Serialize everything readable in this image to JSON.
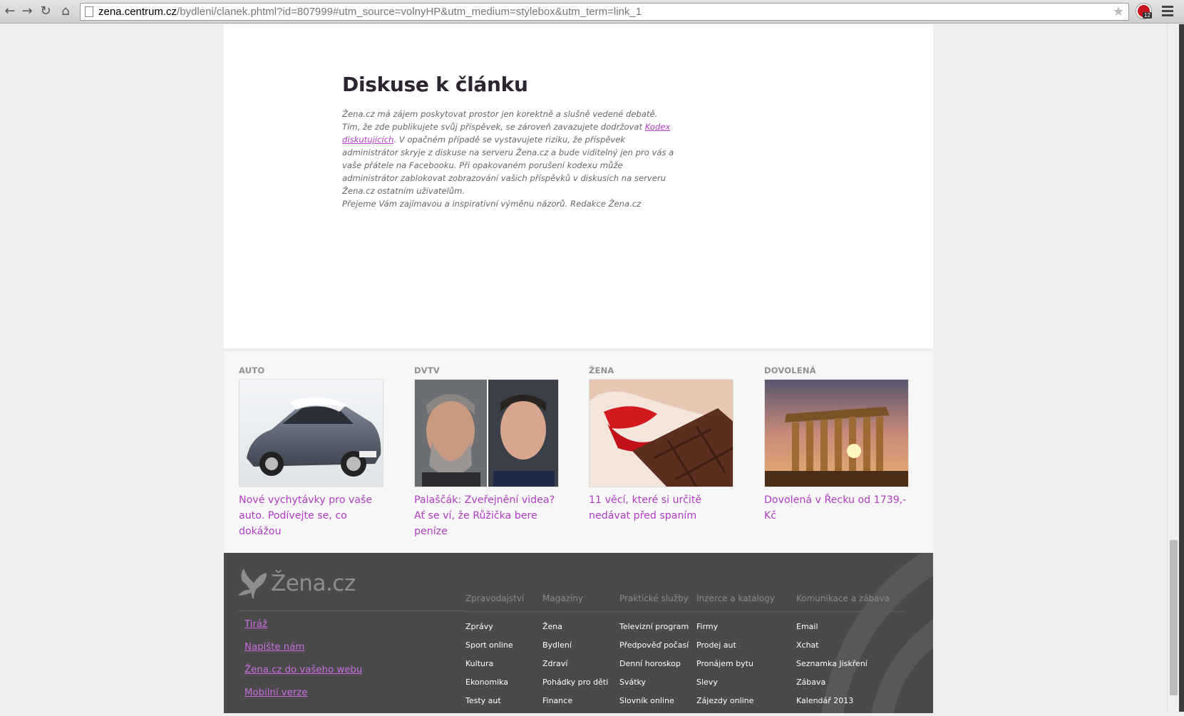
{
  "browser": {
    "url_host": "zena.centrum.cz",
    "url_path": "/bydleni/clanek.phtml?id=807999#utm_source=volnyHP&utm_medium=stylebox&utm_term=link_1",
    "extension_badge": "12"
  },
  "discussion": {
    "title": "Diskuse k článku",
    "text_1": "Žena.cz má zájem poskytovat prostor jen korektně a slušně vedené debatě. Tím, že zde publikujete svůj příspěvek, se zároveň zavazujete dodržovat ",
    "code_link": "Kodex diskutujících",
    "text_2": ". V opačném případě se vystavujete riziku, že příspěvek administrátor skryje z diskuse na serveru Žena.cz a bude viditelný jen pro vás a vaše přátele na Facebooku. Při opakovaném porušení kodexu může administrátor zablokovat zobrazování vašich příspěvků v diskusích na serveru Žena.cz ostatním uživatelům.",
    "text_3": "Přejeme Vám zajímavou a inspirativní výměnu názorů. Redakce Žena.cz"
  },
  "stylebox": [
    {
      "category": "AUTO",
      "title": "Nové vychytávky pro vaše auto. Podívejte se, co dokážou",
      "image": "car-photo"
    },
    {
      "category": "DVTV",
      "title": "Palaščák: Zveřejnění videa? Ať se ví, že Růžička bere peníze",
      "image": "two-men-portrait"
    },
    {
      "category": "ŽENA",
      "title": "11 věcí, které si určitě nedávat před spaním",
      "image": "lips-chocolate-photo"
    },
    {
      "category": "DOVOLENÁ",
      "title": "Dovolená v Řecku od 1739,- Kč",
      "image": "parthenon-photo"
    }
  ],
  "footer": {
    "logo_text": "Žena.cz",
    "links": [
      "Tiráž",
      "Napište nám",
      "Žena.cz do vašeho webu",
      "Mobilní verze"
    ],
    "columns": [
      {
        "heading": "Zpravodajství",
        "items": [
          "Zprávy",
          "Sport online",
          "Kultura",
          "Ekonomika",
          "Testy aut"
        ]
      },
      {
        "heading": "Magazíny",
        "items": [
          "Žena",
          "Bydlení",
          "Zdraví",
          "Pohádky pro děti",
          "Finance"
        ]
      },
      {
        "heading": "Praktické služby",
        "items": [
          "Televizní program",
          "Předpověď počasí",
          "Denní horoskop",
          "Svátky",
          "Slovník online"
        ]
      },
      {
        "heading": "Inzerce a katalogy",
        "items": [
          "Firmy",
          "Prodej aut",
          "Pronájem bytu",
          "Slevy",
          "Zájezdy online"
        ]
      },
      {
        "heading": "Komunikace a zábava",
        "items": [
          "Email",
          "Xchat",
          "Seznamka Jiskření",
          "Zábava",
          "Kalendář 2013"
        ]
      }
    ]
  },
  "colors": {
    "link_purple": "#b03cc4",
    "footer_bg": "#4a4a4a",
    "footer_link": "#c86ee0"
  }
}
